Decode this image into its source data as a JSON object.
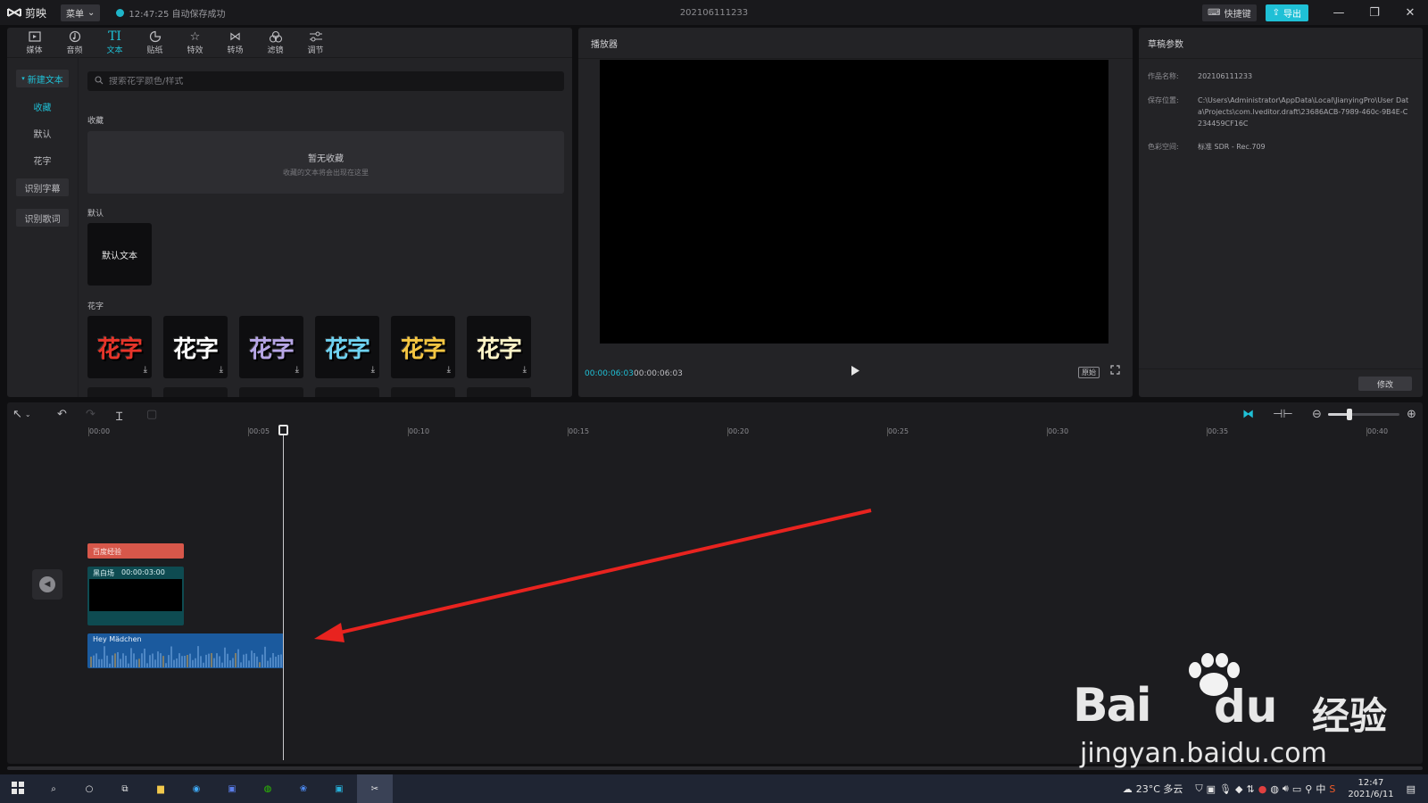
{
  "titlebar": {
    "app_name": "剪映",
    "menu_label": "菜单",
    "save_status": "12:47:25 自动保存成功",
    "project_title": "202106111233",
    "shortcut_label": "快捷键",
    "export_label": "导出"
  },
  "toolbar": {
    "items": [
      {
        "label": "媒体",
        "icon": "media-icon"
      },
      {
        "label": "音频",
        "icon": "audio-icon"
      },
      {
        "label": "文本",
        "icon": "text-icon"
      },
      {
        "label": "贴纸",
        "icon": "sticker-icon"
      },
      {
        "label": "特效",
        "icon": "effects-icon"
      },
      {
        "label": "转场",
        "icon": "transition-icon"
      },
      {
        "label": "滤镜",
        "icon": "filter-icon"
      },
      {
        "label": "调节",
        "icon": "adjust-icon"
      }
    ],
    "active_index": 2
  },
  "categories": {
    "new_text": "新建文本",
    "favorites": "收藏",
    "default": "默认",
    "fancy": "花字",
    "recognize_subtitles": "识别字幕",
    "recognize_lyrics": "识别歌词"
  },
  "text_panel": {
    "search_placeholder": "搜索花字颜色/样式",
    "fav_section": "收藏",
    "fav_empty_title": "暂无收藏",
    "fav_empty_desc": "收藏的文本将会出现在这里",
    "default_section": "默认",
    "default_tile": "默认文本",
    "fancy_section": "花字",
    "fancy_tiles": [
      {
        "text": "花字",
        "color": "#e8352a"
      },
      {
        "text": "花字",
        "color": "#ffffff"
      },
      {
        "text": "花字",
        "color": "#b7a6e6"
      },
      {
        "text": "花字",
        "color": "#6fd3f2"
      },
      {
        "text": "花字",
        "color": "#f5c642"
      },
      {
        "text": "花字",
        "color": "#fff5c8"
      }
    ]
  },
  "player": {
    "header": "播放器",
    "current_time": "00:00:06:03",
    "total_time": "00:00:06:03",
    "ratio_label": "原始"
  },
  "draft": {
    "header": "草稿参数",
    "name_key": "作品名称:",
    "name_value": "202106111233",
    "path_key": "保存位置:",
    "path_value": "C:\\Users\\Administrator\\AppData\\Local\\JianyingPro\\User Data\\Projects\\com.lveditor.draft\\23686ACB-7989-460c-9B4E-C234459CF16C",
    "color_key": "色彩空间:",
    "color_value": "标准 SDR - Rec.709",
    "modify_label": "修改"
  },
  "timeline": {
    "ticks": [
      "00:00",
      "00:05",
      "00:10",
      "00:15",
      "00:20",
      "00:25",
      "00:30",
      "00:35",
      "00:40"
    ],
    "text_clip": "百度经验",
    "video_clip_name": "黑白场",
    "video_clip_duration": "00:00:03:00",
    "audio_clip": "Hey Mädchen",
    "zoom_level": 0.3
  },
  "watermark": {
    "bai": "Bai",
    "du": "du",
    "jy": "经验",
    "url": "jingyan.baidu.com"
  },
  "taskbar": {
    "weather": "23°C 多云",
    "ime": "中",
    "time": "12:47",
    "date": "2021/6/11"
  },
  "colors": {
    "accent": "#1fc0d6",
    "text_clip": "#d7574a",
    "video_clip": "#0e4b51",
    "audio_clip": "#1b5a9e",
    "annotation_arrow": "#e8231f"
  }
}
